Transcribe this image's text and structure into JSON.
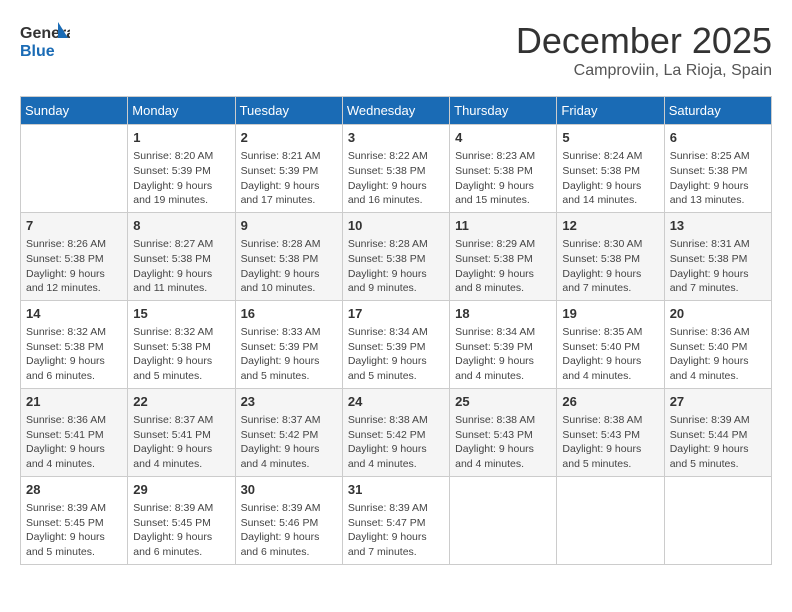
{
  "header": {
    "logo_line1": "General",
    "logo_line2": "Blue",
    "month_title": "December 2025",
    "location": "Camproviin, La Rioja, Spain"
  },
  "days_of_week": [
    "Sunday",
    "Monday",
    "Tuesday",
    "Wednesday",
    "Thursday",
    "Friday",
    "Saturday"
  ],
  "weeks": [
    [
      {
        "day": "",
        "info": ""
      },
      {
        "day": "1",
        "info": "Sunrise: 8:20 AM\nSunset: 5:39 PM\nDaylight: 9 hours\nand 19 minutes."
      },
      {
        "day": "2",
        "info": "Sunrise: 8:21 AM\nSunset: 5:39 PM\nDaylight: 9 hours\nand 17 minutes."
      },
      {
        "day": "3",
        "info": "Sunrise: 8:22 AM\nSunset: 5:38 PM\nDaylight: 9 hours\nand 16 minutes."
      },
      {
        "day": "4",
        "info": "Sunrise: 8:23 AM\nSunset: 5:38 PM\nDaylight: 9 hours\nand 15 minutes."
      },
      {
        "day": "5",
        "info": "Sunrise: 8:24 AM\nSunset: 5:38 PM\nDaylight: 9 hours\nand 14 minutes."
      },
      {
        "day": "6",
        "info": "Sunrise: 8:25 AM\nSunset: 5:38 PM\nDaylight: 9 hours\nand 13 minutes."
      }
    ],
    [
      {
        "day": "7",
        "info": "Sunrise: 8:26 AM\nSunset: 5:38 PM\nDaylight: 9 hours\nand 12 minutes."
      },
      {
        "day": "8",
        "info": "Sunrise: 8:27 AM\nSunset: 5:38 PM\nDaylight: 9 hours\nand 11 minutes."
      },
      {
        "day": "9",
        "info": "Sunrise: 8:28 AM\nSunset: 5:38 PM\nDaylight: 9 hours\nand 10 minutes."
      },
      {
        "day": "10",
        "info": "Sunrise: 8:28 AM\nSunset: 5:38 PM\nDaylight: 9 hours\nand 9 minutes."
      },
      {
        "day": "11",
        "info": "Sunrise: 8:29 AM\nSunset: 5:38 PM\nDaylight: 9 hours\nand 8 minutes."
      },
      {
        "day": "12",
        "info": "Sunrise: 8:30 AM\nSunset: 5:38 PM\nDaylight: 9 hours\nand 7 minutes."
      },
      {
        "day": "13",
        "info": "Sunrise: 8:31 AM\nSunset: 5:38 PM\nDaylight: 9 hours\nand 7 minutes."
      }
    ],
    [
      {
        "day": "14",
        "info": "Sunrise: 8:32 AM\nSunset: 5:38 PM\nDaylight: 9 hours\nand 6 minutes."
      },
      {
        "day": "15",
        "info": "Sunrise: 8:32 AM\nSunset: 5:38 PM\nDaylight: 9 hours\nand 5 minutes."
      },
      {
        "day": "16",
        "info": "Sunrise: 8:33 AM\nSunset: 5:39 PM\nDaylight: 9 hours\nand 5 minutes."
      },
      {
        "day": "17",
        "info": "Sunrise: 8:34 AM\nSunset: 5:39 PM\nDaylight: 9 hours\nand 5 minutes."
      },
      {
        "day": "18",
        "info": "Sunrise: 8:34 AM\nSunset: 5:39 PM\nDaylight: 9 hours\nand 4 minutes."
      },
      {
        "day": "19",
        "info": "Sunrise: 8:35 AM\nSunset: 5:40 PM\nDaylight: 9 hours\nand 4 minutes."
      },
      {
        "day": "20",
        "info": "Sunrise: 8:36 AM\nSunset: 5:40 PM\nDaylight: 9 hours\nand 4 minutes."
      }
    ],
    [
      {
        "day": "21",
        "info": "Sunrise: 8:36 AM\nSunset: 5:41 PM\nDaylight: 9 hours\nand 4 minutes."
      },
      {
        "day": "22",
        "info": "Sunrise: 8:37 AM\nSunset: 5:41 PM\nDaylight: 9 hours\nand 4 minutes."
      },
      {
        "day": "23",
        "info": "Sunrise: 8:37 AM\nSunset: 5:42 PM\nDaylight: 9 hours\nand 4 minutes."
      },
      {
        "day": "24",
        "info": "Sunrise: 8:38 AM\nSunset: 5:42 PM\nDaylight: 9 hours\nand 4 minutes."
      },
      {
        "day": "25",
        "info": "Sunrise: 8:38 AM\nSunset: 5:43 PM\nDaylight: 9 hours\nand 4 minutes."
      },
      {
        "day": "26",
        "info": "Sunrise: 8:38 AM\nSunset: 5:43 PM\nDaylight: 9 hours\nand 5 minutes."
      },
      {
        "day": "27",
        "info": "Sunrise: 8:39 AM\nSunset: 5:44 PM\nDaylight: 9 hours\nand 5 minutes."
      }
    ],
    [
      {
        "day": "28",
        "info": "Sunrise: 8:39 AM\nSunset: 5:45 PM\nDaylight: 9 hours\nand 5 minutes."
      },
      {
        "day": "29",
        "info": "Sunrise: 8:39 AM\nSunset: 5:45 PM\nDaylight: 9 hours\nand 6 minutes."
      },
      {
        "day": "30",
        "info": "Sunrise: 8:39 AM\nSunset: 5:46 PM\nDaylight: 9 hours\nand 6 minutes."
      },
      {
        "day": "31",
        "info": "Sunrise: 8:39 AM\nSunset: 5:47 PM\nDaylight: 9 hours\nand 7 minutes."
      },
      {
        "day": "",
        "info": ""
      },
      {
        "day": "",
        "info": ""
      },
      {
        "day": "",
        "info": ""
      }
    ]
  ]
}
